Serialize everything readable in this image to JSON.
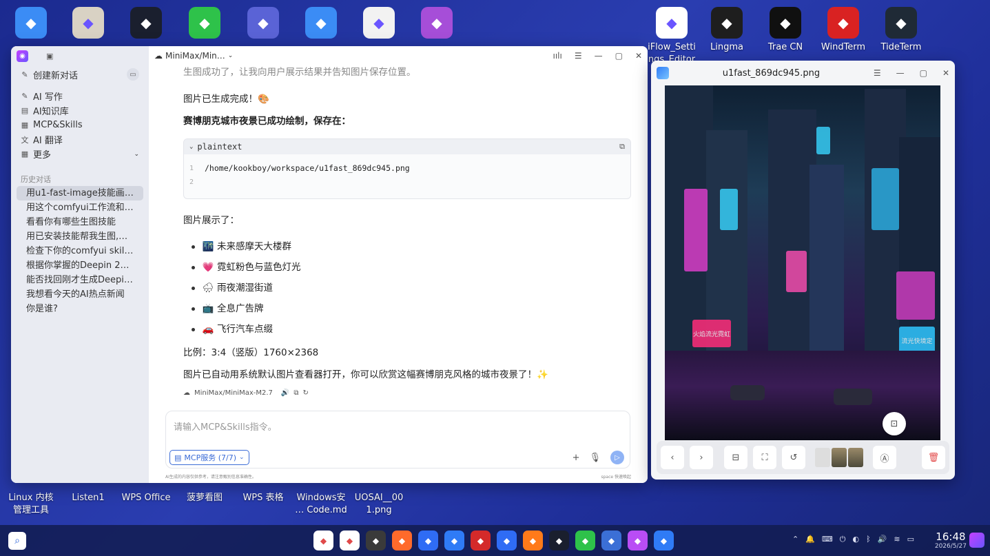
{
  "desktop": {
    "top_icons": [
      {
        "label": "",
        "icon": "folder-icon",
        "color": "#3b8cf5"
      },
      {
        "label": "",
        "icon": "next-app-icon",
        "color": "#d9d2c4"
      },
      {
        "label": "",
        "icon": "m-app-icon",
        "color": "#1a1f2e"
      },
      {
        "label": "",
        "icon": "wechat-icon",
        "color": "#2ec24a"
      },
      {
        "label": "",
        "icon": "cleaner-icon",
        "color": "#5a63d6"
      },
      {
        "label": "",
        "icon": "folder-icon",
        "color": "#3b8cf5"
      },
      {
        "label": "",
        "icon": "document-icon",
        "color": "#f2f2f2"
      },
      {
        "label": "",
        "icon": "markdown-icon",
        "color": "#a64ed8"
      },
      {
        "label": "iFlow_Setti\nngs_Editor",
        "icon": "iflow-icon",
        "color": "#ffffff"
      },
      {
        "label": "Lingma",
        "icon": "lingma-icon",
        "color": "#1e1e1e"
      },
      {
        "label": "Trae CN",
        "icon": "trae-icon",
        "color": "#101010"
      },
      {
        "label": "WindTerm",
        "icon": "windterm-icon",
        "color": "#d92222"
      },
      {
        "label": "TideTerm",
        "icon": "tideterm-icon",
        "color": "#1f2a36"
      }
    ],
    "bottom_icons": [
      {
        "label": "Linux 内核\n管理工具"
      },
      {
        "label": "Listen1"
      },
      {
        "label": "WPS Office"
      },
      {
        "label": "菠萝看图"
      },
      {
        "label": "WPS 表格"
      },
      {
        "label": "Windows安\n… Code.md"
      },
      {
        "label": "UOSAI__00\n1.png"
      }
    ]
  },
  "chat": {
    "sidebar": {
      "new_chat": "创建新对话",
      "nav": [
        {
          "label": "AI 写作",
          "icon": "pen-icon"
        },
        {
          "label": "AI知识库",
          "icon": "knowledge-icon"
        },
        {
          "label": "MCP&Skills",
          "icon": "tools-icon"
        },
        {
          "label": "AI 翻译",
          "icon": "translate-icon"
        },
        {
          "label": "更多",
          "icon": "grid-icon"
        }
      ],
      "history_title": "历史对话",
      "history": [
        "用u1-fast-image技能画一幅赛博朋克城市夜景",
        "用这个comfyui工作流和你的能力生图",
        "看看你有哪些生图技能",
        "用已安装技能帮我生图,就以赛博朋克为主题",
        "检查下你的comfyui skill技能是否可用",
        "根据你掌握的Deepin 25操作知识回答",
        "能否找回刚才生成Deepin 25壁纸",
        "我想看今天的AI热点新闻",
        "你是谁?"
      ]
    },
    "header": {
      "model": "MiniMax/Min…"
    },
    "messages": {
      "intro": "生图成功了，让我向用户展示结果并告知图片保存位置。",
      "done": "图片已生成完成！🎨",
      "saved": "赛博朋克城市夜景已成功绘制，保存在：",
      "code_lang": "plaintext",
      "code_lines": [
        "/home/kookboy/workspace/u1fast_869dc945.png",
        ""
      ],
      "shows": "图片展示了：",
      "features": [
        {
          "emoji": "🌃",
          "text": "未来感摩天大楼群"
        },
        {
          "emoji": "💗",
          "text": "霓虹粉色与蓝色灯光"
        },
        {
          "emoji": "🌧",
          "text": "雨夜潮湿街道"
        },
        {
          "emoji": "📺",
          "text": "全息广告牌"
        },
        {
          "emoji": "🚗",
          "text": "飞行汽车点缀"
        }
      ],
      "ratio": "比例：3:4（竖版）1760×2368",
      "opened": "图片已自动用系统默认图片查看器打开，你可以欣赏这幅赛博朋克风格的城市夜景了！✨",
      "model_tag": "MiniMax/MiniMax-M2.7"
    },
    "composer": {
      "placeholder": "请输入MCP&Skills指令。",
      "mcp_chip": "MCP服务 (7/7)",
      "disclaimer": "AI生成的内容仅供参考，请注意甄别信息准确性。",
      "shortcut": "space 快速唤起"
    }
  },
  "viewer": {
    "title": "u1fast_869dc945.png",
    "neon_signs": [
      "火焰流光霓虹",
      "流光快境定"
    ]
  },
  "taskbar": {
    "time": "16:48",
    "date": "2026/5/27",
    "dock": [
      {
        "icon": "launcher-icon",
        "color": "#ffffff"
      },
      {
        "icon": "multitask-icon",
        "color": "#ffffff"
      },
      {
        "icon": "settings-icon",
        "color": "#3a3a3a"
      },
      {
        "icon": "app-store-icon",
        "color": "#ff6a2b"
      },
      {
        "icon": "monitor-icon",
        "color": "#2f6cf5"
      },
      {
        "icon": "file-manager-icon",
        "color": "#2f7bf6"
      },
      {
        "icon": "terminal-icon",
        "color": "#d42a2a"
      },
      {
        "icon": "chat-app-icon",
        "color": "#2f6cf5"
      },
      {
        "icon": "firefox-icon",
        "color": "#ff7a1a"
      },
      {
        "icon": "m-app-icon",
        "color": "#1a1f2e"
      },
      {
        "icon": "wechat-icon",
        "color": "#2ec24a"
      },
      {
        "icon": "code-editor-icon",
        "color": "#3b6fd6"
      },
      {
        "icon": "ai-assistant-icon",
        "color": "#b94df5"
      },
      {
        "icon": "image-viewer-icon",
        "color": "#2f7bf6"
      }
    ]
  }
}
